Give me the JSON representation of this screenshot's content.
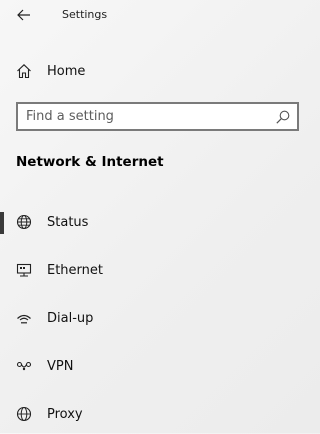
{
  "window": {
    "title": "Settings"
  },
  "nav": {
    "home_label": "Home"
  },
  "search": {
    "placeholder": "Find a setting",
    "value": ""
  },
  "section": {
    "heading": "Network & Internet"
  },
  "menu": {
    "items": [
      {
        "label": "Status",
        "icon": "globe-icon",
        "selected": true
      },
      {
        "label": "Ethernet",
        "icon": "ethernet-icon",
        "selected": false
      },
      {
        "label": "Dial-up",
        "icon": "dial-up-icon",
        "selected": false
      },
      {
        "label": "VPN",
        "icon": "vpn-icon",
        "selected": false
      },
      {
        "label": "Proxy",
        "icon": "globe-icon",
        "selected": false
      }
    ]
  },
  "colors": {
    "background": "#f2f2f2",
    "selection_indicator": "#3a3a3a",
    "search_border": "#7a7a7a"
  }
}
